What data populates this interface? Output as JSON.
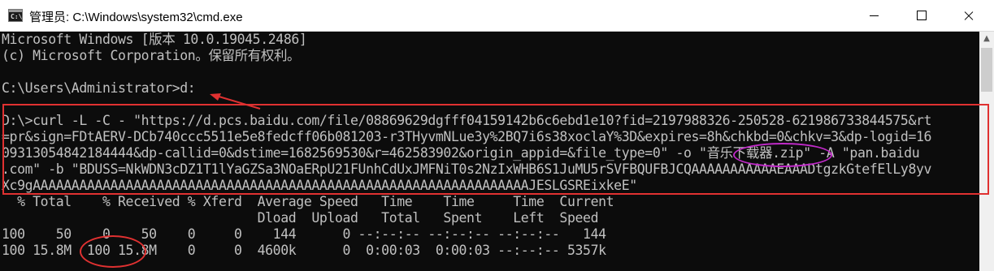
{
  "window": {
    "title": "管理员: C:\\Windows\\system32\\cmd.exe",
    "icon_text": "C:\\"
  },
  "console": {
    "lines": [
      "Microsoft Windows [版本 10.0.19045.2486]",
      "(c) Microsoft Corporation。保留所有权利。",
      "",
      "C:\\Users\\Administrator>d:",
      "",
      "D:\\>curl -L -C - \"https://d.pcs.baidu.com/file/08869629dgfff04159142b6c6ebd1e10?fid=2197988326-250528-621986733844575&rt",
      "=pr&sign=FDtAERV-DCb740ccc5511e5e8fedcff06b081203-r3THyvmNLue3y%2BQ7i6s38xoclaY%3D&expires=8h&chkbd=0&chkv=3&dp-logid=16",
      "09313054842184444&dp-callid=0&dstime=1682569530&r=462583902&origin_appid=&file_type=0\" -o \"音乐下载器.zip\" -A \"pan.baidu",
      ".com\" -b \"BDUSS=NkWDN3cDZ1T1lYaGZSa3NOaERpU21FUnhCdUxJMFNiT0s2NzIxWHB6S1JuMU5rSVFBQUFBJCQAAAAAAAAAAAEAAADtgzkGtefElLy8yv",
      "Xc9gAAAAAAAAAAAAAAAAAAAAAAAAAAAAAAAAAAAAAAAAAAAAAAAAAAAAAAAAAAAAAAAAJESLGSREixkeE\"",
      "  % Total    % Received % Xferd  Average Speed   Time    Time     Time  Current",
      "                                 Dload  Upload   Total   Spent    Left  Speed",
      "100    50    0    50    0     0    144      0 --:--:-- --:--:-- --:--:--   144",
      "100 15.8M  100 15.8M    0     0  4600k      0  0:00:03  0:00:03 --:--:-- 5357k"
    ]
  },
  "scrollbar": {
    "up_arrow": "▲"
  },
  "colors": {
    "background": "#0c0c0c",
    "text": "#c0c0c0",
    "annotation_red": "#e03131",
    "annotation_purple": "#c02ac8"
  }
}
